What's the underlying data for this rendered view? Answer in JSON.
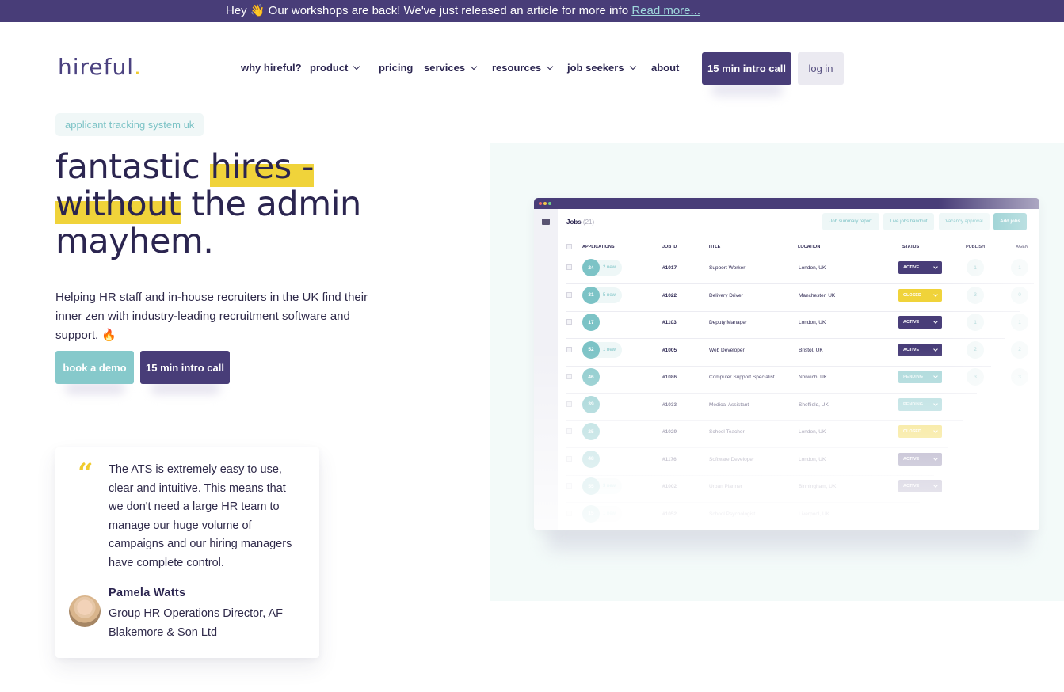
{
  "announcement": {
    "text": "Hey 👋 Our workshops are back! We've just released an article for more info",
    "link": "Read more..."
  },
  "brand": {
    "name": "hireful",
    "dot": ".",
    "primary": "#483d78",
    "accent": "#7cc3c6",
    "yellow": "#f0d33a"
  },
  "nav": {
    "items": [
      {
        "label": "why hireful?",
        "dropdown": false
      },
      {
        "label": "product",
        "dropdown": true
      },
      {
        "label": "pricing",
        "dropdown": false
      },
      {
        "label": "services",
        "dropdown": true
      },
      {
        "label": "resources",
        "dropdown": true
      },
      {
        "label": "job seekers",
        "dropdown": true
      },
      {
        "label": "about",
        "dropdown": false
      }
    ],
    "cta": "15 min intro call",
    "login": "log in"
  },
  "hero": {
    "tag": "applicant tracking system uk",
    "headline": {
      "part1": "fantastic ",
      "hl1": "hires -",
      "hl2": "without",
      "part2": " the admin",
      "part3": "mayhem."
    },
    "subtext": "Helping HR staff and in-house recruiters in the UK find their inner zen with industry-leading recruitment software and support. 🔥",
    "btn_demo": "book a demo",
    "btn_intro": "15 min intro call"
  },
  "testimonial": {
    "quote_mark": "“",
    "quote": "The ATS is extremely easy to use, clear and intuitive. This means that we don't need a large HR team to manage our huge volume of campaigns and our hiring managers have complete control.",
    "name": "Pamela Watts",
    "role": "Group HR Operations Director, AF Blakemore & Son Ltd"
  },
  "mockup": {
    "title": "Jobs",
    "count": "(21)",
    "toolbar": [
      "Job summary report",
      "Live jobs handout",
      "Vacancy approval",
      "Add jobs"
    ],
    "columns": [
      "APPLICATIONS",
      "JOB ID",
      "TITLE",
      "LOCATION",
      "STATUS",
      "PUBLISH",
      "AGEN"
    ],
    "rows": [
      {
        "apps": "24",
        "new": "2 new",
        "id": "#1017",
        "title": "Support Worker",
        "location": "London, UK",
        "status": "ACTIVE",
        "publish": "1",
        "agen": "1"
      },
      {
        "apps": "31",
        "new": "5 new",
        "id": "#1022",
        "title": "Delivery Driver",
        "location": "Manchester, UK",
        "status": "CLOSED",
        "publish": "3",
        "agen": "0"
      },
      {
        "apps": "17",
        "new": "",
        "id": "#1103",
        "title": "Deputy Manager",
        "location": "London, UK",
        "status": "ACTIVE",
        "publish": "1",
        "agen": "1"
      },
      {
        "apps": "52",
        "new": "1 new",
        "id": "#1005",
        "title": "Web Developer",
        "location": "Bristol, UK",
        "status": "ACTIVE",
        "publish": "2",
        "agen": "2"
      },
      {
        "apps": "46",
        "new": "",
        "id": "#1086",
        "title": "Computer Support Specialist",
        "location": "Norwich, UK",
        "status": "PENDING",
        "publish": "3",
        "agen": "3"
      },
      {
        "apps": "39",
        "new": "",
        "id": "#1033",
        "title": "Medical Assistant",
        "location": "Sheffield, UK",
        "status": "PENDING",
        "publish": "",
        "agen": ""
      },
      {
        "apps": "25",
        "new": "",
        "id": "#1029",
        "title": "School Teacher",
        "location": "London, UK",
        "status": "CLOSED",
        "publish": "",
        "agen": ""
      },
      {
        "apps": "48",
        "new": "",
        "id": "#1176",
        "title": "Software Developer",
        "location": "London, UK",
        "status": "ACTIVE",
        "publish": "",
        "agen": ""
      },
      {
        "apps": "55",
        "new": "3 new",
        "id": "#1002",
        "title": "Urban Planner",
        "location": "Birmingham, UK",
        "status": "ACTIVE",
        "publish": "",
        "agen": ""
      },
      {
        "apps": "15",
        "new": "1 new",
        "id": "#1052",
        "title": "School Psychologist",
        "location": "Liverpool, UK",
        "status": "",
        "publish": "",
        "agen": ""
      }
    ],
    "status_colors": {
      "ACTIVE": "#483d78",
      "CLOSED": "#f0d33a",
      "PENDING": "#9fd3d5"
    }
  }
}
